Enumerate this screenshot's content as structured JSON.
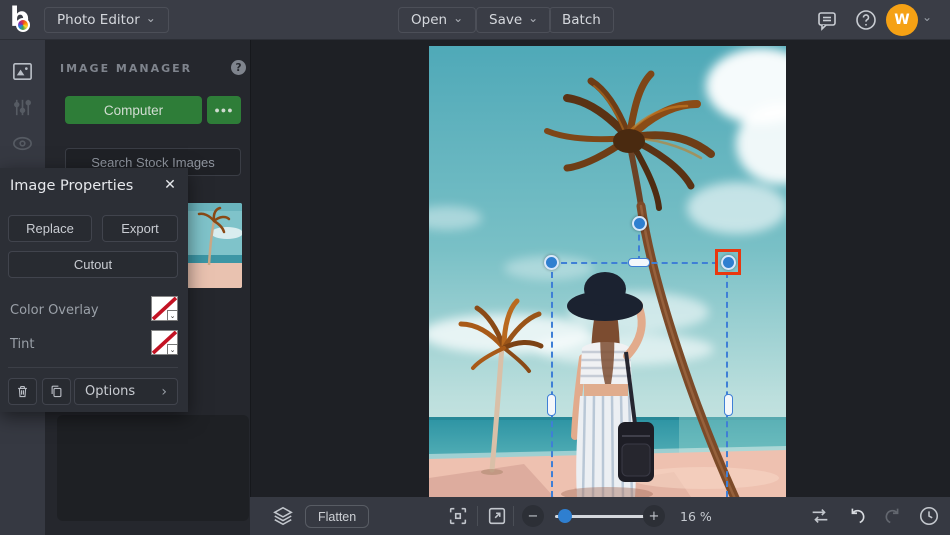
{
  "topbar": {
    "app_title": "Photo Editor",
    "open_label": "Open",
    "save_label": "Save",
    "batch_label": "Batch",
    "avatar_initial": "W"
  },
  "icons": {
    "chevron_down": "⌄",
    "more": "●●●",
    "close": "✕",
    "question": "?",
    "options_arrow": "›",
    "minus": "−",
    "plus": "+"
  },
  "image_manager": {
    "title": "IMAGE MANAGER",
    "computer_label": "Computer",
    "search_placeholder": "Search Stock Images"
  },
  "image_properties": {
    "title": "Image Properties",
    "replace_label": "Replace",
    "export_label": "Export",
    "cutout_label": "Cutout",
    "color_overlay_label": "Color Overlay",
    "tint_label": "Tint",
    "options_label": "Options"
  },
  "bottombar": {
    "flatten_label": "Flatten",
    "zoom_level": "16 %"
  },
  "colors": {
    "accent_blue": "#2f7fd0",
    "button_green": "#2e7d38",
    "avatar_orange": "#f5a114",
    "selection_highlight_red": "#e8380f"
  }
}
